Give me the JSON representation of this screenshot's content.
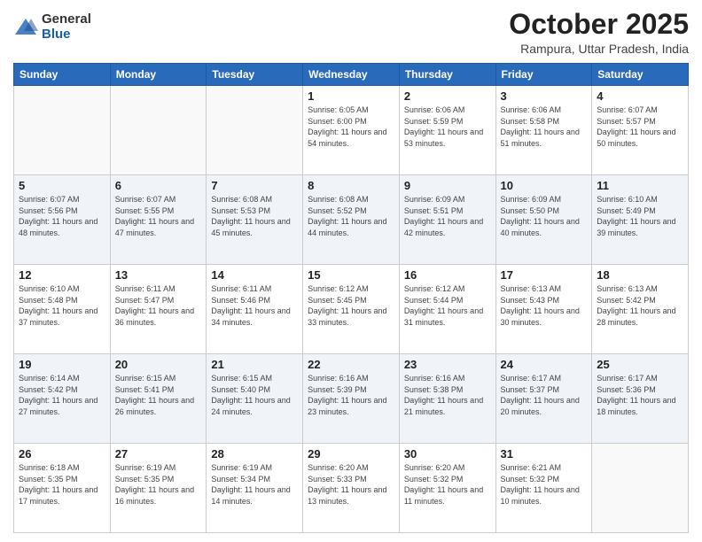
{
  "logo": {
    "general": "General",
    "blue": "Blue"
  },
  "header": {
    "month": "October 2025",
    "location": "Rampura, Uttar Pradesh, India"
  },
  "weekdays": [
    "Sunday",
    "Monday",
    "Tuesday",
    "Wednesday",
    "Thursday",
    "Friday",
    "Saturday"
  ],
  "weeks": [
    [
      {
        "day": "",
        "info": ""
      },
      {
        "day": "",
        "info": ""
      },
      {
        "day": "",
        "info": ""
      },
      {
        "day": "1",
        "info": "Sunrise: 6:05 AM\nSunset: 6:00 PM\nDaylight: 11 hours\nand 54 minutes."
      },
      {
        "day": "2",
        "info": "Sunrise: 6:06 AM\nSunset: 5:59 PM\nDaylight: 11 hours\nand 53 minutes."
      },
      {
        "day": "3",
        "info": "Sunrise: 6:06 AM\nSunset: 5:58 PM\nDaylight: 11 hours\nand 51 minutes."
      },
      {
        "day": "4",
        "info": "Sunrise: 6:07 AM\nSunset: 5:57 PM\nDaylight: 11 hours\nand 50 minutes."
      }
    ],
    [
      {
        "day": "5",
        "info": "Sunrise: 6:07 AM\nSunset: 5:56 PM\nDaylight: 11 hours\nand 48 minutes."
      },
      {
        "day": "6",
        "info": "Sunrise: 6:07 AM\nSunset: 5:55 PM\nDaylight: 11 hours\nand 47 minutes."
      },
      {
        "day": "7",
        "info": "Sunrise: 6:08 AM\nSunset: 5:53 PM\nDaylight: 11 hours\nand 45 minutes."
      },
      {
        "day": "8",
        "info": "Sunrise: 6:08 AM\nSunset: 5:52 PM\nDaylight: 11 hours\nand 44 minutes."
      },
      {
        "day": "9",
        "info": "Sunrise: 6:09 AM\nSunset: 5:51 PM\nDaylight: 11 hours\nand 42 minutes."
      },
      {
        "day": "10",
        "info": "Sunrise: 6:09 AM\nSunset: 5:50 PM\nDaylight: 11 hours\nand 40 minutes."
      },
      {
        "day": "11",
        "info": "Sunrise: 6:10 AM\nSunset: 5:49 PM\nDaylight: 11 hours\nand 39 minutes."
      }
    ],
    [
      {
        "day": "12",
        "info": "Sunrise: 6:10 AM\nSunset: 5:48 PM\nDaylight: 11 hours\nand 37 minutes."
      },
      {
        "day": "13",
        "info": "Sunrise: 6:11 AM\nSunset: 5:47 PM\nDaylight: 11 hours\nand 36 minutes."
      },
      {
        "day": "14",
        "info": "Sunrise: 6:11 AM\nSunset: 5:46 PM\nDaylight: 11 hours\nand 34 minutes."
      },
      {
        "day": "15",
        "info": "Sunrise: 6:12 AM\nSunset: 5:45 PM\nDaylight: 11 hours\nand 33 minutes."
      },
      {
        "day": "16",
        "info": "Sunrise: 6:12 AM\nSunset: 5:44 PM\nDaylight: 11 hours\nand 31 minutes."
      },
      {
        "day": "17",
        "info": "Sunrise: 6:13 AM\nSunset: 5:43 PM\nDaylight: 11 hours\nand 30 minutes."
      },
      {
        "day": "18",
        "info": "Sunrise: 6:13 AM\nSunset: 5:42 PM\nDaylight: 11 hours\nand 28 minutes."
      }
    ],
    [
      {
        "day": "19",
        "info": "Sunrise: 6:14 AM\nSunset: 5:42 PM\nDaylight: 11 hours\nand 27 minutes."
      },
      {
        "day": "20",
        "info": "Sunrise: 6:15 AM\nSunset: 5:41 PM\nDaylight: 11 hours\nand 26 minutes."
      },
      {
        "day": "21",
        "info": "Sunrise: 6:15 AM\nSunset: 5:40 PM\nDaylight: 11 hours\nand 24 minutes."
      },
      {
        "day": "22",
        "info": "Sunrise: 6:16 AM\nSunset: 5:39 PM\nDaylight: 11 hours\nand 23 minutes."
      },
      {
        "day": "23",
        "info": "Sunrise: 6:16 AM\nSunset: 5:38 PM\nDaylight: 11 hours\nand 21 minutes."
      },
      {
        "day": "24",
        "info": "Sunrise: 6:17 AM\nSunset: 5:37 PM\nDaylight: 11 hours\nand 20 minutes."
      },
      {
        "day": "25",
        "info": "Sunrise: 6:17 AM\nSunset: 5:36 PM\nDaylight: 11 hours\nand 18 minutes."
      }
    ],
    [
      {
        "day": "26",
        "info": "Sunrise: 6:18 AM\nSunset: 5:35 PM\nDaylight: 11 hours\nand 17 minutes."
      },
      {
        "day": "27",
        "info": "Sunrise: 6:19 AM\nSunset: 5:35 PM\nDaylight: 11 hours\nand 16 minutes."
      },
      {
        "day": "28",
        "info": "Sunrise: 6:19 AM\nSunset: 5:34 PM\nDaylight: 11 hours\nand 14 minutes."
      },
      {
        "day": "29",
        "info": "Sunrise: 6:20 AM\nSunset: 5:33 PM\nDaylight: 11 hours\nand 13 minutes."
      },
      {
        "day": "30",
        "info": "Sunrise: 6:20 AM\nSunset: 5:32 PM\nDaylight: 11 hours\nand 11 minutes."
      },
      {
        "day": "31",
        "info": "Sunrise: 6:21 AM\nSunset: 5:32 PM\nDaylight: 11 hours\nand 10 minutes."
      },
      {
        "day": "",
        "info": ""
      }
    ]
  ]
}
